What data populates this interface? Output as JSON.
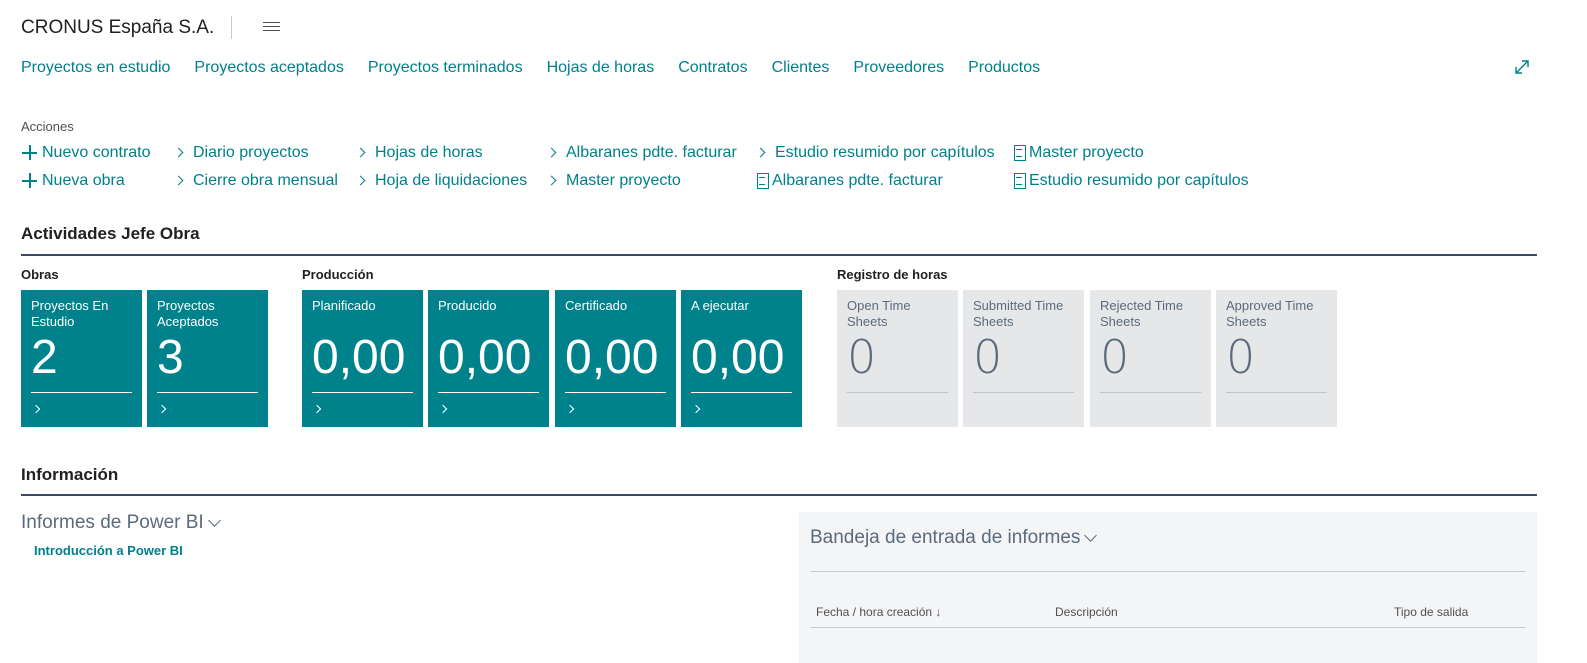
{
  "header": {
    "company": "CRONUS España S.A.",
    "nav": [
      "Proyectos en estudio",
      "Proyectos aceptados",
      "Proyectos terminados",
      "Hojas de horas",
      "Contratos",
      "Clientes",
      "Proveedores",
      "Productos"
    ]
  },
  "actions": {
    "label": "Acciones",
    "nuevo_contrato": "Nuevo contrato",
    "nueva_obra": "Nueva obra",
    "diario_proyectos": "Diario proyectos",
    "cierre_obra_mensual": "Cierre obra mensual",
    "hojas_de_horas": "Hojas de horas",
    "hoja_de_liquidaciones": "Hoja de liquidaciones",
    "albaranes_pdte_facturar": "Albaranes pdte. facturar",
    "master_proyecto": "Master proyecto",
    "estudio_resumido": "Estudio resumido por capítulos",
    "albaranes_report": "Albaranes pdte. facturar",
    "master_proyecto_report": "Master proyecto",
    "estudio_resumido_report": "Estudio resumido por capítulos"
  },
  "activities": {
    "title": "Actividades Jefe Obra",
    "groups": {
      "obras": "Obras",
      "produccion": "Producción",
      "registro": "Registro de horas"
    },
    "tiles": [
      {
        "title": "Proyectos En Estudio",
        "value": "2"
      },
      {
        "title": "Proyectos Aceptados",
        "value": "3"
      },
      {
        "title": "Planificado",
        "value": "0,00"
      },
      {
        "title": "Producido",
        "value": "0,00"
      },
      {
        "title": "Certificado",
        "value": "0,00"
      },
      {
        "title": "A ejecutar",
        "value": "0,00"
      },
      {
        "title": "Open Time Sheets",
        "value": "0"
      },
      {
        "title": "Submitted Time Sheets",
        "value": "0"
      },
      {
        "title": "Rejected Time Sheets",
        "value": "0"
      },
      {
        "title": "Approved Time Sheets",
        "value": "0"
      }
    ]
  },
  "info": {
    "title": "Información",
    "powerbi_title": "Informes de Power BI",
    "powerbi_link": "Introducción a Power BI",
    "inbox_title": "Bandeja de entrada de informes",
    "columns": [
      "Fecha / hora creación ↓",
      "Descripción",
      "Tipo de salida"
    ]
  },
  "colors": {
    "accent": "#00808b",
    "tile_teal": "#00828c",
    "tile_grey": "#e6e7e8"
  }
}
